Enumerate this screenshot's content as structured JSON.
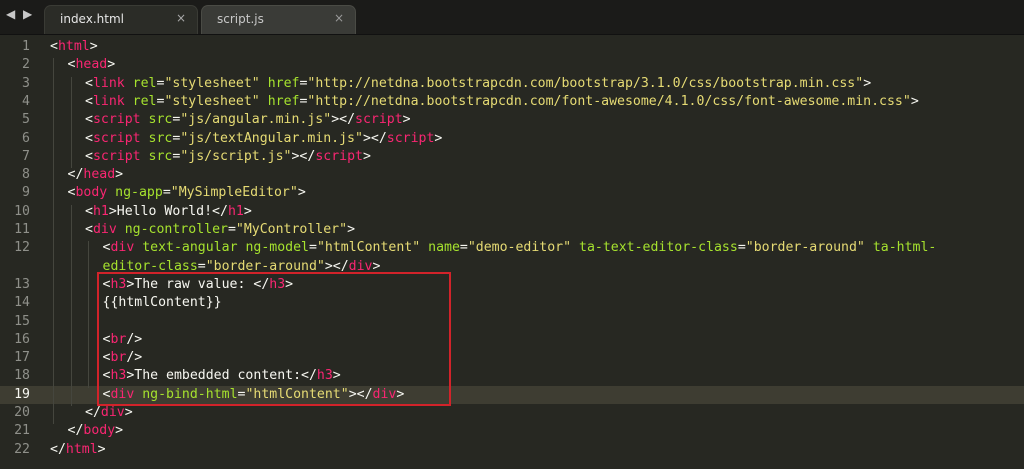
{
  "tabs": [
    {
      "label": "index.html",
      "active": true,
      "close": "×"
    },
    {
      "label": "script.js",
      "active": false,
      "close": "×"
    }
  ],
  "nav": {
    "arrows": "◀ ▶"
  },
  "current_line": 19,
  "lines": [
    {
      "n": "1",
      "segs": [
        {
          "t": "<",
          "c": "txt"
        },
        {
          "t": "html",
          "c": "tag"
        },
        {
          "t": ">",
          "c": "txt"
        }
      ],
      "indent": 0
    },
    {
      "n": "2",
      "segs": [
        {
          "t": "<",
          "c": "txt"
        },
        {
          "t": "head",
          "c": "tag"
        },
        {
          "t": ">",
          "c": "txt"
        }
      ],
      "indent": 1
    },
    {
      "n": "3",
      "segs": [
        {
          "t": "<",
          "c": "txt"
        },
        {
          "t": "link",
          "c": "tag"
        },
        {
          "t": " ",
          "c": "txt"
        },
        {
          "t": "rel",
          "c": "attr"
        },
        {
          "t": "=",
          "c": "txt"
        },
        {
          "t": "\"stylesheet\"",
          "c": "str"
        },
        {
          "t": " ",
          "c": "txt"
        },
        {
          "t": "href",
          "c": "attr"
        },
        {
          "t": "=",
          "c": "txt"
        },
        {
          "t": "\"http://netdna.bootstrapcdn.com/bootstrap/3.1.0/css/bootstrap.min.css\"",
          "c": "str"
        },
        {
          "t": ">",
          "c": "txt"
        }
      ],
      "indent": 2
    },
    {
      "n": "4",
      "segs": [
        {
          "t": "<",
          "c": "txt"
        },
        {
          "t": "link",
          "c": "tag"
        },
        {
          "t": " ",
          "c": "txt"
        },
        {
          "t": "rel",
          "c": "attr"
        },
        {
          "t": "=",
          "c": "txt"
        },
        {
          "t": "\"stylesheet\"",
          "c": "str"
        },
        {
          "t": " ",
          "c": "txt"
        },
        {
          "t": "href",
          "c": "attr"
        },
        {
          "t": "=",
          "c": "txt"
        },
        {
          "t": "\"http://netdna.bootstrapcdn.com/font-awesome/4.1.0/css/font-awesome.min.css\"",
          "c": "str"
        },
        {
          "t": ">",
          "c": "txt"
        }
      ],
      "indent": 2
    },
    {
      "n": "5",
      "segs": [
        {
          "t": "<",
          "c": "txt"
        },
        {
          "t": "script",
          "c": "tag"
        },
        {
          "t": " ",
          "c": "txt"
        },
        {
          "t": "src",
          "c": "attr"
        },
        {
          "t": "=",
          "c": "txt"
        },
        {
          "t": "\"js/angular.min.js\"",
          "c": "str"
        },
        {
          "t": "></",
          "c": "txt"
        },
        {
          "t": "script",
          "c": "tag"
        },
        {
          "t": ">",
          "c": "txt"
        }
      ],
      "indent": 2
    },
    {
      "n": "6",
      "segs": [
        {
          "t": "<",
          "c": "txt"
        },
        {
          "t": "script",
          "c": "tag"
        },
        {
          "t": " ",
          "c": "txt"
        },
        {
          "t": "src",
          "c": "attr"
        },
        {
          "t": "=",
          "c": "txt"
        },
        {
          "t": "\"js/textAngular.min.js\"",
          "c": "str"
        },
        {
          "t": "></",
          "c": "txt"
        },
        {
          "t": "script",
          "c": "tag"
        },
        {
          "t": ">",
          "c": "txt"
        }
      ],
      "indent": 2
    },
    {
      "n": "7",
      "segs": [
        {
          "t": "<",
          "c": "txt"
        },
        {
          "t": "script",
          "c": "tag"
        },
        {
          "t": " ",
          "c": "txt"
        },
        {
          "t": "src",
          "c": "attr"
        },
        {
          "t": "=",
          "c": "txt"
        },
        {
          "t": "\"js/script.js\"",
          "c": "str"
        },
        {
          "t": "></",
          "c": "txt"
        },
        {
          "t": "script",
          "c": "tag"
        },
        {
          "t": ">",
          "c": "txt"
        }
      ],
      "indent": 2
    },
    {
      "n": "8",
      "segs": [
        {
          "t": "</",
          "c": "txt"
        },
        {
          "t": "head",
          "c": "tag"
        },
        {
          "t": ">",
          "c": "txt"
        }
      ],
      "indent": 1
    },
    {
      "n": "9",
      "segs": [
        {
          "t": "<",
          "c": "txt"
        },
        {
          "t": "body",
          "c": "tag"
        },
        {
          "t": " ",
          "c": "txt"
        },
        {
          "t": "ng-app",
          "c": "attr"
        },
        {
          "t": "=",
          "c": "txt"
        },
        {
          "t": "\"MySimpleEditor\"",
          "c": "str"
        },
        {
          "t": ">",
          "c": "txt"
        }
      ],
      "indent": 1
    },
    {
      "n": "10",
      "segs": [
        {
          "t": "<",
          "c": "txt"
        },
        {
          "t": "h1",
          "c": "tag"
        },
        {
          "t": ">Hello World!</",
          "c": "txt"
        },
        {
          "t": "h1",
          "c": "tag"
        },
        {
          "t": ">",
          "c": "txt"
        }
      ],
      "indent": 2
    },
    {
      "n": "11",
      "segs": [
        {
          "t": "<",
          "c": "txt"
        },
        {
          "t": "div",
          "c": "tag"
        },
        {
          "t": " ",
          "c": "txt"
        },
        {
          "t": "ng-controller",
          "c": "attr"
        },
        {
          "t": "=",
          "c": "txt"
        },
        {
          "t": "\"MyController\"",
          "c": "str"
        },
        {
          "t": ">",
          "c": "txt"
        }
      ],
      "indent": 2
    },
    {
      "n": "12",
      "segs": [
        {
          "t": "<",
          "c": "txt"
        },
        {
          "t": "div",
          "c": "tag"
        },
        {
          "t": " ",
          "c": "txt"
        },
        {
          "t": "text-angular",
          "c": "attr"
        },
        {
          "t": " ",
          "c": "txt"
        },
        {
          "t": "ng-model",
          "c": "attr"
        },
        {
          "t": "=",
          "c": "txt"
        },
        {
          "t": "\"htmlContent\"",
          "c": "str"
        },
        {
          "t": " ",
          "c": "txt"
        },
        {
          "t": "name",
          "c": "attr"
        },
        {
          "t": "=",
          "c": "txt"
        },
        {
          "t": "\"demo-editor\"",
          "c": "str"
        },
        {
          "t": " ",
          "c": "txt"
        },
        {
          "t": "ta-text-editor-class",
          "c": "attr"
        },
        {
          "t": "=",
          "c": "txt"
        },
        {
          "t": "\"border-around\"",
          "c": "str"
        },
        {
          "t": " ",
          "c": "txt"
        },
        {
          "t": "ta-html-",
          "c": "attr"
        }
      ],
      "indent": 3
    },
    {
      "n": "",
      "segs": [
        {
          "t": "editor-class",
          "c": "attr"
        },
        {
          "t": "=",
          "c": "txt"
        },
        {
          "t": "\"border-around\"",
          "c": "str"
        },
        {
          "t": "></",
          "c": "txt"
        },
        {
          "t": "div",
          "c": "tag"
        },
        {
          "t": ">",
          "c": "txt"
        }
      ],
      "indent": 3
    },
    {
      "n": "13",
      "segs": [
        {
          "t": "<",
          "c": "txt"
        },
        {
          "t": "h3",
          "c": "tag"
        },
        {
          "t": ">The raw value: </",
          "c": "txt"
        },
        {
          "t": "h3",
          "c": "tag"
        },
        {
          "t": ">",
          "c": "txt"
        }
      ],
      "indent": 3
    },
    {
      "n": "14",
      "segs": [
        {
          "t": "{{htmlContent}}",
          "c": "txt"
        }
      ],
      "indent": 3
    },
    {
      "n": "15",
      "segs": [],
      "indent": 3
    },
    {
      "n": "16",
      "segs": [
        {
          "t": "<",
          "c": "txt"
        },
        {
          "t": "br",
          "c": "tag"
        },
        {
          "t": "/>",
          "c": "txt"
        }
      ],
      "indent": 3
    },
    {
      "n": "17",
      "segs": [
        {
          "t": "<",
          "c": "txt"
        },
        {
          "t": "br",
          "c": "tag"
        },
        {
          "t": "/>",
          "c": "txt"
        }
      ],
      "indent": 3
    },
    {
      "n": "18",
      "segs": [
        {
          "t": "<",
          "c": "txt"
        },
        {
          "t": "h3",
          "c": "tag"
        },
        {
          "t": ">The embedded content:</",
          "c": "txt"
        },
        {
          "t": "h3",
          "c": "tag"
        },
        {
          "t": ">",
          "c": "txt"
        }
      ],
      "indent": 3
    },
    {
      "n": "19",
      "segs": [
        {
          "t": "<",
          "c": "txt"
        },
        {
          "t": "div",
          "c": "tag"
        },
        {
          "t": " ",
          "c": "txt"
        },
        {
          "t": "ng-bind-html",
          "c": "attr"
        },
        {
          "t": "=",
          "c": "txt"
        },
        {
          "t": "\"htmlContent\"",
          "c": "str"
        },
        {
          "t": "></",
          "c": "txt"
        },
        {
          "t": "div",
          "c": "tag"
        },
        {
          "t": ">",
          "c": "txt"
        }
      ],
      "indent": 3
    },
    {
      "n": "20",
      "segs": [
        {
          "t": "</",
          "c": "txt"
        },
        {
          "t": "div",
          "c": "tag"
        },
        {
          "t": ">",
          "c": "txt"
        }
      ],
      "indent": 2
    },
    {
      "n": "21",
      "segs": [
        {
          "t": "</",
          "c": "txt"
        },
        {
          "t": "body",
          "c": "tag"
        },
        {
          "t": ">",
          "c": "txt"
        }
      ],
      "indent": 1
    },
    {
      "n": "22",
      "segs": [
        {
          "t": "</",
          "c": "txt"
        },
        {
          "t": "html",
          "c": "tag"
        },
        {
          "t": ">",
          "c": "txt"
        }
      ],
      "indent": 0
    }
  ],
  "colors": {
    "tag": "#f92672",
    "attr": "#a6e22e",
    "string": "#e6db74",
    "text": "#f8f8f2",
    "highlight_box": "#d2232a"
  }
}
